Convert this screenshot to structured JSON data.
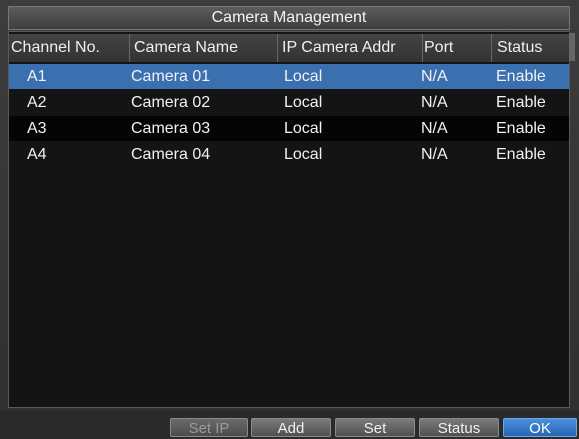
{
  "window": {
    "title": "Camera Management"
  },
  "table": {
    "headers": [
      "Channel No.",
      "Camera Name",
      "IP Camera Addr",
      "Port",
      "Status"
    ],
    "rows": [
      [
        "A1",
        "Camera 01",
        "Local",
        "N/A",
        "Enable"
      ],
      [
        "A2",
        "Camera 02",
        "Local",
        "N/A",
        "Enable"
      ],
      [
        "A3",
        "Camera 03",
        "Local",
        "N/A",
        "Enable"
      ],
      [
        "A4",
        "Camera 04",
        "Local",
        "N/A",
        "Enable"
      ]
    ],
    "selected_row": "A1"
  },
  "buttons": {
    "set_ip": "Set IP",
    "add": "Add",
    "set": "Set",
    "status": "Status",
    "ok": "OK"
  }
}
